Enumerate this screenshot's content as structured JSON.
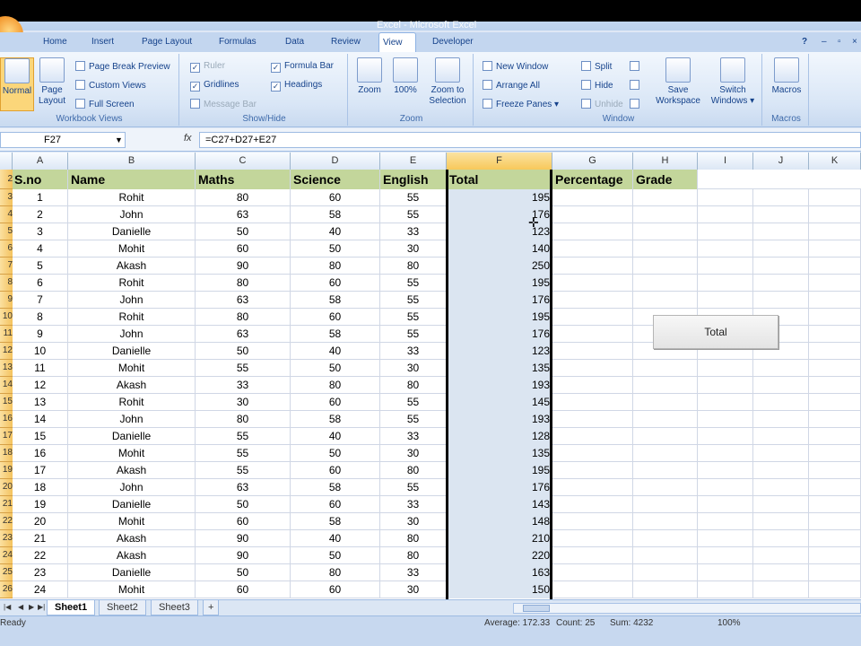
{
  "window": {
    "title": "Excel - Microsoft Excel"
  },
  "tabs": [
    "Home",
    "Insert",
    "Page Layout",
    "Formulas",
    "Data",
    "Review",
    "View",
    "Developer"
  ],
  "active_tab": "View",
  "ribbon": {
    "workbook_views": {
      "label": "Workbook Views",
      "normal": "Normal",
      "page_layout": "Page Layout",
      "page_break": "Page Break Preview",
      "custom_views": "Custom Views",
      "full_screen": "Full Screen"
    },
    "show_hide": {
      "label": "Show/Hide",
      "ruler": "Ruler",
      "gridlines": "Gridlines",
      "message_bar": "Message Bar",
      "formula_bar": "Formula Bar",
      "headings": "Headings"
    },
    "zoom": {
      "label": "Zoom",
      "zoom": "Zoom",
      "hundred": "100%",
      "zoom_to": "Zoom to",
      "selection": "Selection"
    },
    "window": {
      "label": "Window",
      "new_window": "New Window",
      "arrange_all": "Arrange All",
      "freeze_panes": "Freeze Panes",
      "split": "Split",
      "hide": "Hide",
      "unhide": "Unhide",
      "save_ws": "Save",
      "save_ws2": "Workspace",
      "switch": "Switch",
      "switch2": "Windows"
    },
    "macros": {
      "label": "Macros",
      "macros": "Macros"
    }
  },
  "formula_bar": {
    "name_box": "F27",
    "fx": "fx",
    "formula": "=C27+D27+E27"
  },
  "columns": [
    "A",
    "B",
    "C",
    "D",
    "E",
    "F",
    "G",
    "H",
    "I",
    "J",
    "K"
  ],
  "header_row": {
    "row": "2",
    "cells": [
      "S.no",
      "Name",
      "Maths",
      "Science",
      "English",
      "Total",
      "Percentage",
      "Grade"
    ]
  },
  "rows": [
    {
      "r": "3",
      "sno": "1",
      "name": "Rohit",
      "maths": "80",
      "science": "60",
      "english": "55",
      "total": "195"
    },
    {
      "r": "4",
      "sno": "2",
      "name": "John",
      "maths": "63",
      "science": "58",
      "english": "55",
      "total": "176"
    },
    {
      "r": "5",
      "sno": "3",
      "name": "Danielle",
      "maths": "50",
      "science": "40",
      "english": "33",
      "total": "123"
    },
    {
      "r": "6",
      "sno": "4",
      "name": "Mohit",
      "maths": "60",
      "science": "50",
      "english": "30",
      "total": "140"
    },
    {
      "r": "7",
      "sno": "5",
      "name": "Akash",
      "maths": "90",
      "science": "80",
      "english": "80",
      "total": "250"
    },
    {
      "r": "8",
      "sno": "6",
      "name": "Rohit",
      "maths": "80",
      "science": "60",
      "english": "55",
      "total": "195"
    },
    {
      "r": "9",
      "sno": "7",
      "name": "John",
      "maths": "63",
      "science": "58",
      "english": "55",
      "total": "176"
    },
    {
      "r": "10",
      "sno": "8",
      "name": "Rohit",
      "maths": "80",
      "science": "60",
      "english": "55",
      "total": "195"
    },
    {
      "r": "11",
      "sno": "9",
      "name": "John",
      "maths": "63",
      "science": "58",
      "english": "55",
      "total": "176"
    },
    {
      "r": "12",
      "sno": "10",
      "name": "Danielle",
      "maths": "50",
      "science": "40",
      "english": "33",
      "total": "123"
    },
    {
      "r": "13",
      "sno": "11",
      "name": "Mohit",
      "maths": "55",
      "science": "50",
      "english": "30",
      "total": "135"
    },
    {
      "r": "14",
      "sno": "12",
      "name": "Akash",
      "maths": "33",
      "science": "80",
      "english": "80",
      "total": "193"
    },
    {
      "r": "15",
      "sno": "13",
      "name": "Rohit",
      "maths": "30",
      "science": "60",
      "english": "55",
      "total": "145"
    },
    {
      "r": "16",
      "sno": "14",
      "name": "John",
      "maths": "80",
      "science": "58",
      "english": "55",
      "total": "193"
    },
    {
      "r": "17",
      "sno": "15",
      "name": "Danielle",
      "maths": "55",
      "science": "40",
      "english": "33",
      "total": "128"
    },
    {
      "r": "18",
      "sno": "16",
      "name": "Mohit",
      "maths": "55",
      "science": "50",
      "english": "30",
      "total": "135"
    },
    {
      "r": "19",
      "sno": "17",
      "name": "Akash",
      "maths": "55",
      "science": "60",
      "english": "80",
      "total": "195"
    },
    {
      "r": "20",
      "sno": "18",
      "name": "John",
      "maths": "63",
      "science": "58",
      "english": "55",
      "total": "176"
    },
    {
      "r": "21",
      "sno": "19",
      "name": "Danielle",
      "maths": "50",
      "science": "60",
      "english": "33",
      "total": "143"
    },
    {
      "r": "22",
      "sno": "20",
      "name": "Mohit",
      "maths": "60",
      "science": "58",
      "english": "30",
      "total": "148"
    },
    {
      "r": "23",
      "sno": "21",
      "name": "Akash",
      "maths": "90",
      "science": "40",
      "english": "80",
      "total": "210"
    },
    {
      "r": "24",
      "sno": "22",
      "name": "Akash",
      "maths": "90",
      "science": "50",
      "english": "80",
      "total": "220"
    },
    {
      "r": "25",
      "sno": "23",
      "name": "Danielle",
      "maths": "50",
      "science": "80",
      "english": "33",
      "total": "163"
    },
    {
      "r": "26",
      "sno": "24",
      "name": "Mohit",
      "maths": "60",
      "science": "60",
      "english": "30",
      "total": "150"
    }
  ],
  "total_button": {
    "label": "Total"
  },
  "sheets": [
    "Sheet1",
    "Sheet2",
    "Sheet3"
  ],
  "active_sheet": "Sheet1",
  "status": {
    "ready": "Ready",
    "average": "Average: 172.33",
    "count": "Count: 25",
    "sum": "Sum: 4232",
    "zoom": "100%"
  }
}
